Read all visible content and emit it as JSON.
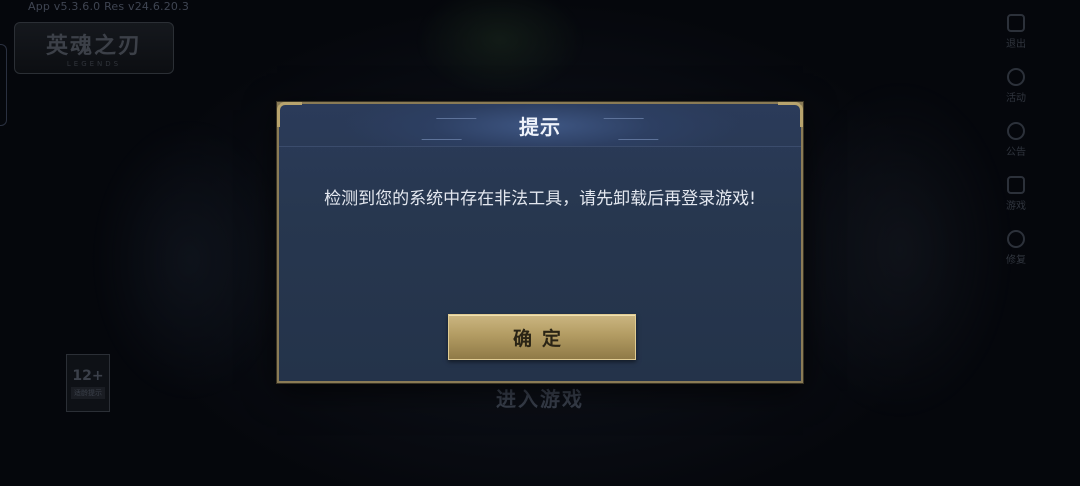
{
  "background": {
    "version_text": "App v5.3.6.0   Res v24.6.20.3",
    "logo_title": "英魂之刃",
    "logo_subtitle": "LEGENDS",
    "right_menu": [
      {
        "label": "退出",
        "icon": "logout-icon"
      },
      {
        "label": "活动",
        "icon": "activity-icon"
      },
      {
        "label": "公告",
        "icon": "notice-icon"
      },
      {
        "label": "游戏",
        "icon": "gamepad-icon"
      },
      {
        "label": "修复",
        "icon": "repair-icon"
      }
    ],
    "age_rating": {
      "number": "12+",
      "tag": "适龄提示"
    },
    "enter_game_label": "进入游戏"
  },
  "dialog": {
    "title": "提示",
    "message": "检测到您的系统中存在非法工具，请先卸载后再登录游戏!",
    "confirm_label": "确定"
  },
  "colors": {
    "dialog_bg": "#27374f",
    "dialog_border": "#8a7b56",
    "button_gold": "#b39c63",
    "title_text": "#eef2fa"
  }
}
